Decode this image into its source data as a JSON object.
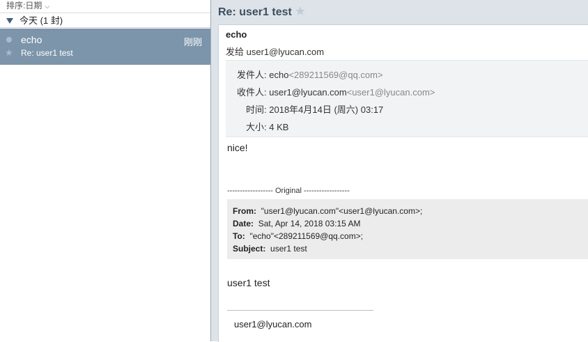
{
  "list": {
    "sort_label": "排序:日期",
    "group_label": "今天 (1 封)",
    "messages": [
      {
        "from": "echo",
        "time": "刚刚",
        "subject": "Re: user1 test"
      }
    ]
  },
  "reader": {
    "title": "Re: user1 test",
    "sender_name": "echo",
    "to_line": "发给 user1@lyucan.com",
    "meta": {
      "from_label": "发件人:",
      "from_name": "echo",
      "from_addr": "<289211569@qq.com>",
      "to_label": "收件人:",
      "to_name": "user1@lyucan.com",
      "to_addr": "<user1@lyucan.com>",
      "time_label": "时间:",
      "time_value": "2018年4月14日 (周六) 03:17",
      "size_label": "大小:",
      "size_value": "4 KB"
    },
    "body_text": "nice!",
    "original_divider": "------------------ Original ------------------",
    "quote": {
      "from_label": "From:",
      "from_value": "\"user1@lyucan.com\"<user1@lyucan.com>;",
      "date_label": "Date:",
      "date_value": "Sat, Apr 14, 2018 03:15 AM",
      "to_label": "To:",
      "to_value": "\"echo\"<289211569@qq.com>;",
      "subject_label": "Subject:",
      "subject_value": "user1 test"
    },
    "quoted_body": "user1 test",
    "signature": "user1@lyucan.com"
  }
}
